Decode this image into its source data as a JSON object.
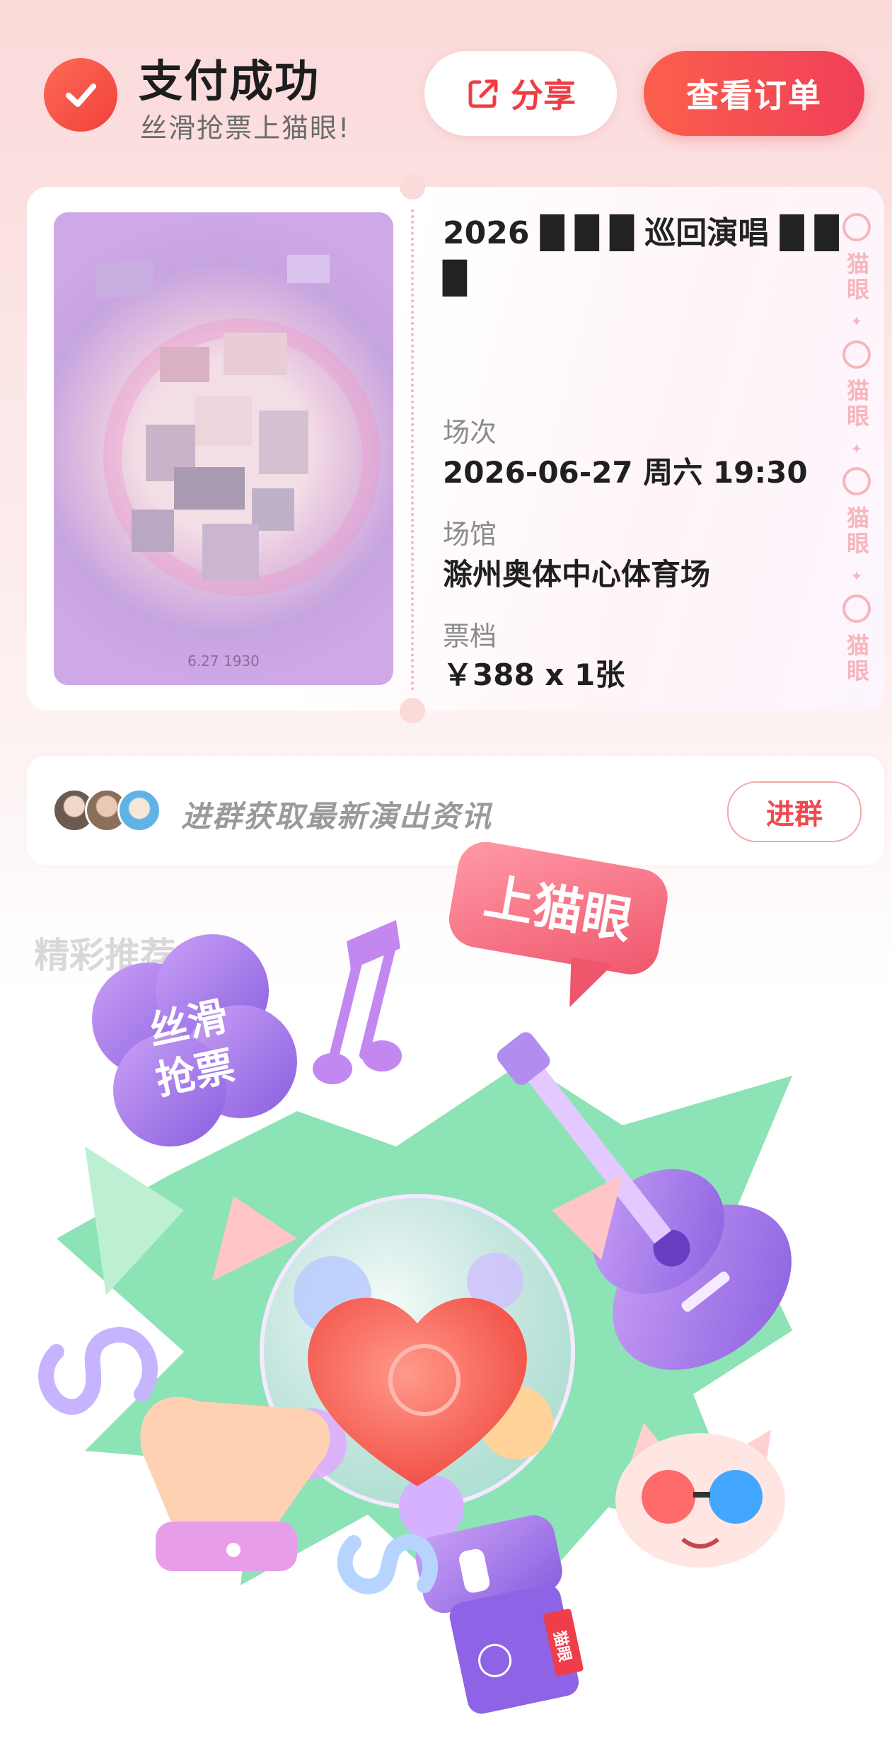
{
  "header": {
    "title": "支付成功",
    "subtitle": "丝滑抢票上猫眼!",
    "share_label": "分享",
    "view_order_label": "查看订单"
  },
  "ticket": {
    "event_title": "2026 █ █ █ 巡回演唱 █ █ █",
    "session_label": "场次",
    "session_value": "2026-06-27 周六 19:30",
    "venue_label": "场馆",
    "venue_value": "滁州奥体中心体育场",
    "price_label": "票档",
    "price_value": "￥388 x 1张",
    "poster_date": "6.27 1930",
    "side_stamp": [
      "猫眼",
      "猫眼",
      "猫眼",
      "猫眼"
    ]
  },
  "group": {
    "text": "进群获取最新演出资讯",
    "join_label": "进群"
  },
  "section": {
    "title": "精彩推荐"
  },
  "banner": {
    "bubble_text": "上猫眼",
    "cloud_text_line1": "丝滑",
    "cloud_text_line2": "抢票",
    "mic_tag": "猫眼"
  },
  "colors": {
    "accent": "#f0413e",
    "accent_gradient_end": "#f03f59",
    "label_gray": "#8b8b8b",
    "text_dark": "#1f1f1f"
  },
  "icons": {
    "check": "check-icon",
    "share": "share-icon"
  }
}
